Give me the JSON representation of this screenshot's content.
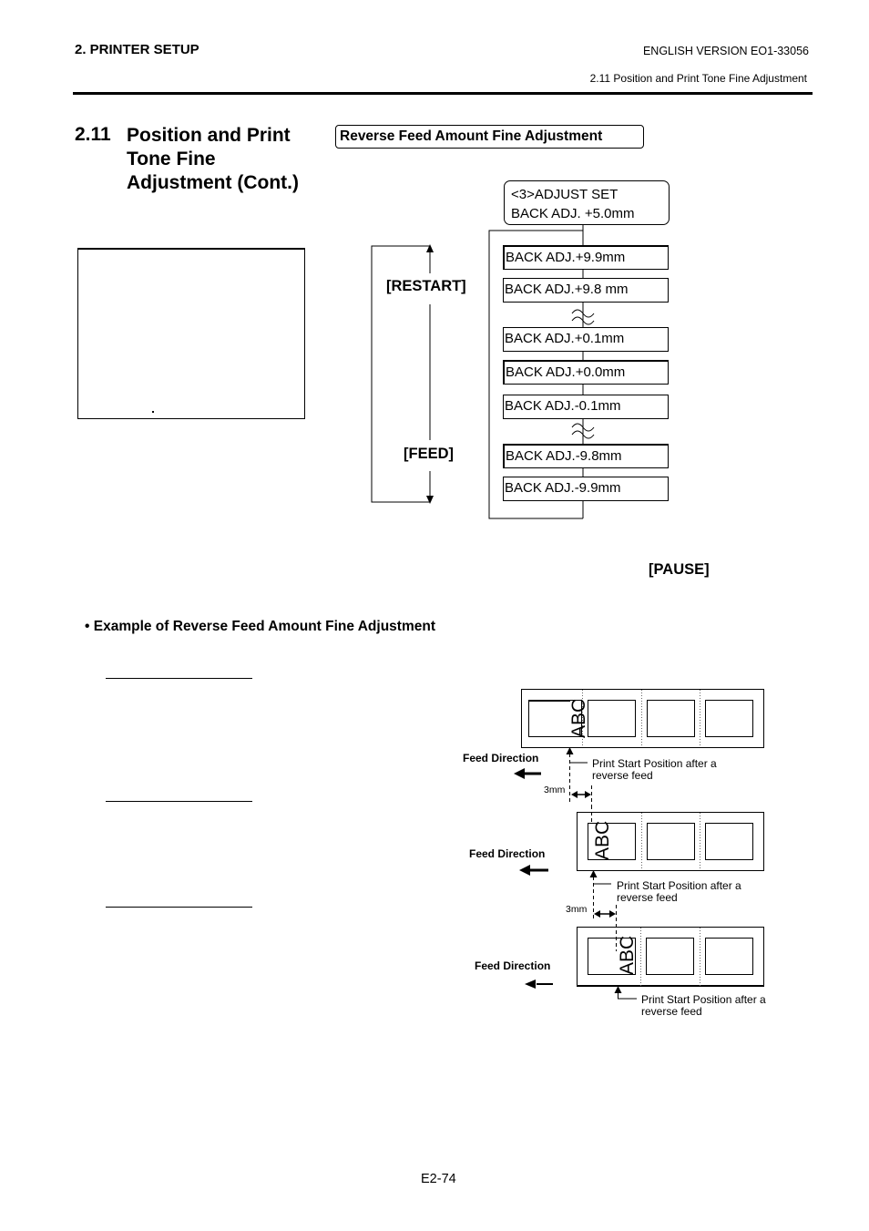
{
  "header": {
    "chapter": "2. PRINTER SETUP",
    "version": "ENGLISH VERSION EO1-33056",
    "subsection": "2.11 Position and Print Tone Fine Adjustment"
  },
  "section": {
    "number": "2.11",
    "title_lines": [
      "Position and Print",
      "Tone Fine",
      "Adjustment (Cont.)"
    ]
  },
  "topic_box": "Reverse Feed Amount Fine Adjustment",
  "lcd": {
    "line1": "<3>ADJUST SET",
    "line2": "BACK ADJ. +5.0mm"
  },
  "flow": {
    "restart_key": "[RESTART]",
    "feed_key": "[FEED]",
    "pause_key": "[PAUSE]",
    "values": [
      "BACK ADJ.+9.9mm",
      "BACK ADJ.+9.8 mm",
      "BACK ADJ.+0.1mm",
      "BACK ADJ.+0.0mm",
      "BACK ADJ.-0.1mm",
      "BACK ADJ.-9.8mm",
      "BACK ADJ.-9.9mm"
    ]
  },
  "example": {
    "title": "Example of Reverse Feed Amount Fine Adjustment",
    "bullet": "•",
    "diagrams": [
      {
        "feed_direction": "Feed Direction",
        "print_start_line1": "Print Start Position after a",
        "print_start_line2": "reverse feed",
        "offset": "3mm",
        "label_text": "ABC"
      },
      {
        "feed_direction": "Feed Direction",
        "print_start_line1": "Print Start Position after a",
        "print_start_line2": "reverse feed",
        "offset": "3mm",
        "label_text": "ABC"
      },
      {
        "feed_direction": "Feed Direction",
        "print_start_line1": "Print Start Position after a",
        "print_start_line2": "reverse feed",
        "label_text": "ABC"
      }
    ]
  },
  "footer": {
    "page_number": "E2-74"
  }
}
